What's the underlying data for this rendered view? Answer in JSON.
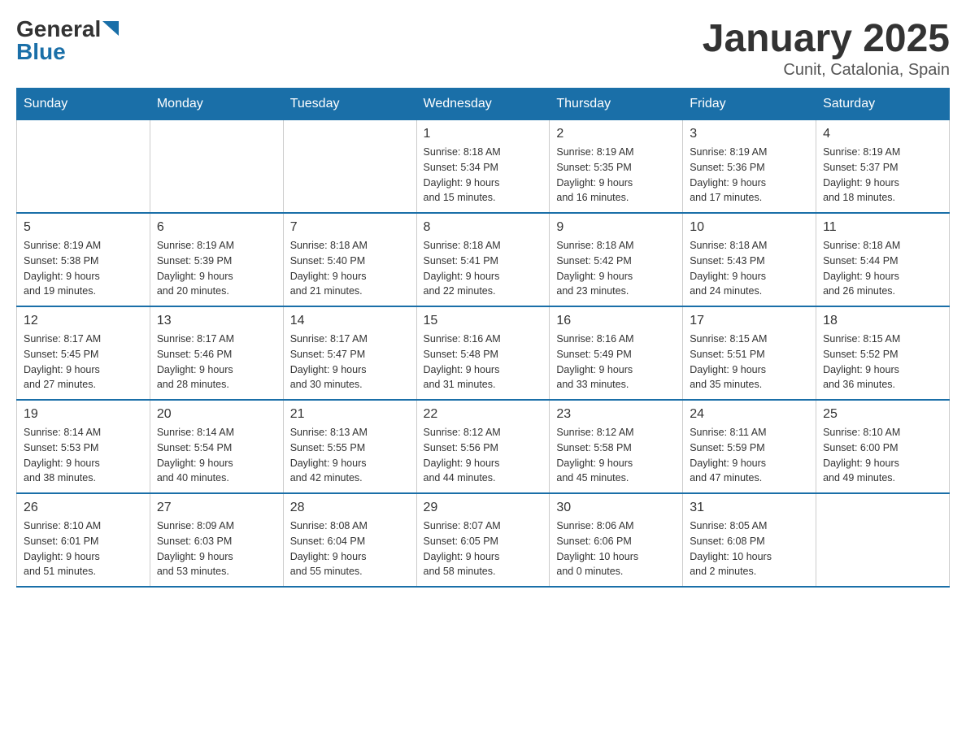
{
  "logo": {
    "text_general": "General",
    "text_blue": "Blue",
    "arrow": "▶"
  },
  "title": "January 2025",
  "subtitle": "Cunit, Catalonia, Spain",
  "days_of_week": [
    "Sunday",
    "Monday",
    "Tuesday",
    "Wednesday",
    "Thursday",
    "Friday",
    "Saturday"
  ],
  "weeks": [
    [
      {
        "day": "",
        "info": ""
      },
      {
        "day": "",
        "info": ""
      },
      {
        "day": "",
        "info": ""
      },
      {
        "day": "1",
        "info": "Sunrise: 8:18 AM\nSunset: 5:34 PM\nDaylight: 9 hours\nand 15 minutes."
      },
      {
        "day": "2",
        "info": "Sunrise: 8:19 AM\nSunset: 5:35 PM\nDaylight: 9 hours\nand 16 minutes."
      },
      {
        "day": "3",
        "info": "Sunrise: 8:19 AM\nSunset: 5:36 PM\nDaylight: 9 hours\nand 17 minutes."
      },
      {
        "day": "4",
        "info": "Sunrise: 8:19 AM\nSunset: 5:37 PM\nDaylight: 9 hours\nand 18 minutes."
      }
    ],
    [
      {
        "day": "5",
        "info": "Sunrise: 8:19 AM\nSunset: 5:38 PM\nDaylight: 9 hours\nand 19 minutes."
      },
      {
        "day": "6",
        "info": "Sunrise: 8:19 AM\nSunset: 5:39 PM\nDaylight: 9 hours\nand 20 minutes."
      },
      {
        "day": "7",
        "info": "Sunrise: 8:18 AM\nSunset: 5:40 PM\nDaylight: 9 hours\nand 21 minutes."
      },
      {
        "day": "8",
        "info": "Sunrise: 8:18 AM\nSunset: 5:41 PM\nDaylight: 9 hours\nand 22 minutes."
      },
      {
        "day": "9",
        "info": "Sunrise: 8:18 AM\nSunset: 5:42 PM\nDaylight: 9 hours\nand 23 minutes."
      },
      {
        "day": "10",
        "info": "Sunrise: 8:18 AM\nSunset: 5:43 PM\nDaylight: 9 hours\nand 24 minutes."
      },
      {
        "day": "11",
        "info": "Sunrise: 8:18 AM\nSunset: 5:44 PM\nDaylight: 9 hours\nand 26 minutes."
      }
    ],
    [
      {
        "day": "12",
        "info": "Sunrise: 8:17 AM\nSunset: 5:45 PM\nDaylight: 9 hours\nand 27 minutes."
      },
      {
        "day": "13",
        "info": "Sunrise: 8:17 AM\nSunset: 5:46 PM\nDaylight: 9 hours\nand 28 minutes."
      },
      {
        "day": "14",
        "info": "Sunrise: 8:17 AM\nSunset: 5:47 PM\nDaylight: 9 hours\nand 30 minutes."
      },
      {
        "day": "15",
        "info": "Sunrise: 8:16 AM\nSunset: 5:48 PM\nDaylight: 9 hours\nand 31 minutes."
      },
      {
        "day": "16",
        "info": "Sunrise: 8:16 AM\nSunset: 5:49 PM\nDaylight: 9 hours\nand 33 minutes."
      },
      {
        "day": "17",
        "info": "Sunrise: 8:15 AM\nSunset: 5:51 PM\nDaylight: 9 hours\nand 35 minutes."
      },
      {
        "day": "18",
        "info": "Sunrise: 8:15 AM\nSunset: 5:52 PM\nDaylight: 9 hours\nand 36 minutes."
      }
    ],
    [
      {
        "day": "19",
        "info": "Sunrise: 8:14 AM\nSunset: 5:53 PM\nDaylight: 9 hours\nand 38 minutes."
      },
      {
        "day": "20",
        "info": "Sunrise: 8:14 AM\nSunset: 5:54 PM\nDaylight: 9 hours\nand 40 minutes."
      },
      {
        "day": "21",
        "info": "Sunrise: 8:13 AM\nSunset: 5:55 PM\nDaylight: 9 hours\nand 42 minutes."
      },
      {
        "day": "22",
        "info": "Sunrise: 8:12 AM\nSunset: 5:56 PM\nDaylight: 9 hours\nand 44 minutes."
      },
      {
        "day": "23",
        "info": "Sunrise: 8:12 AM\nSunset: 5:58 PM\nDaylight: 9 hours\nand 45 minutes."
      },
      {
        "day": "24",
        "info": "Sunrise: 8:11 AM\nSunset: 5:59 PM\nDaylight: 9 hours\nand 47 minutes."
      },
      {
        "day": "25",
        "info": "Sunrise: 8:10 AM\nSunset: 6:00 PM\nDaylight: 9 hours\nand 49 minutes."
      }
    ],
    [
      {
        "day": "26",
        "info": "Sunrise: 8:10 AM\nSunset: 6:01 PM\nDaylight: 9 hours\nand 51 minutes."
      },
      {
        "day": "27",
        "info": "Sunrise: 8:09 AM\nSunset: 6:03 PM\nDaylight: 9 hours\nand 53 minutes."
      },
      {
        "day": "28",
        "info": "Sunrise: 8:08 AM\nSunset: 6:04 PM\nDaylight: 9 hours\nand 55 minutes."
      },
      {
        "day": "29",
        "info": "Sunrise: 8:07 AM\nSunset: 6:05 PM\nDaylight: 9 hours\nand 58 minutes."
      },
      {
        "day": "30",
        "info": "Sunrise: 8:06 AM\nSunset: 6:06 PM\nDaylight: 10 hours\nand 0 minutes."
      },
      {
        "day": "31",
        "info": "Sunrise: 8:05 AM\nSunset: 6:08 PM\nDaylight: 10 hours\nand 2 minutes."
      },
      {
        "day": "",
        "info": ""
      }
    ]
  ]
}
